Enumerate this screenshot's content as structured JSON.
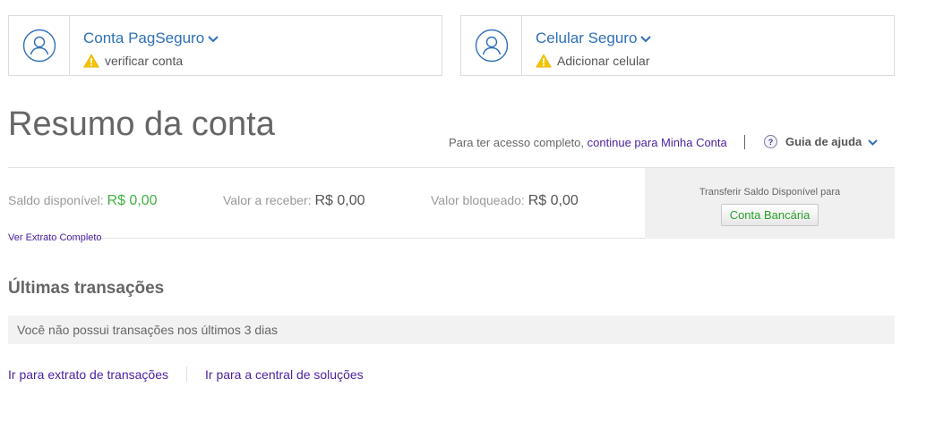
{
  "cards": [
    {
      "title": "Conta PagSeguro",
      "status": "verificar conta"
    },
    {
      "title": "Celular Seguro",
      "status": "Adicionar celular"
    }
  ],
  "icons": {
    "avatar": "user-avatar-icon",
    "warning": "warning-triangle-icon",
    "chevron": "chevron-down-icon",
    "help": "question-circle-icon"
  },
  "colors": {
    "link_blue": "#2f70b7",
    "link_purple": "#4b1fa0",
    "green": "#3fb13f",
    "warning": "#f5c400"
  },
  "page_title": "Resumo da conta",
  "access": {
    "text": "Para ter acesso completo,",
    "link": "continue para Minha Conta"
  },
  "help_label": "Guia de ajuda",
  "balances": {
    "available_label": "Saldo disponível:",
    "available_value": "R$ 0,00",
    "receivable_label": "Valor a receber:",
    "receivable_value": "R$ 0,00",
    "blocked_label": "Valor bloqueado:",
    "blocked_value": "R$ 0,00"
  },
  "extrato_link": "Ver Extrato Completo",
  "transfer": {
    "label": "Transferir Saldo Disponível para",
    "button": "Conta Bancária"
  },
  "transactions": {
    "title": "Últimas transações",
    "empty": "Você não possui transações nos últimos 3 dias"
  },
  "bottom_links": {
    "extrato": "Ir para extrato de transações",
    "central": "Ir para a central de soluções"
  }
}
